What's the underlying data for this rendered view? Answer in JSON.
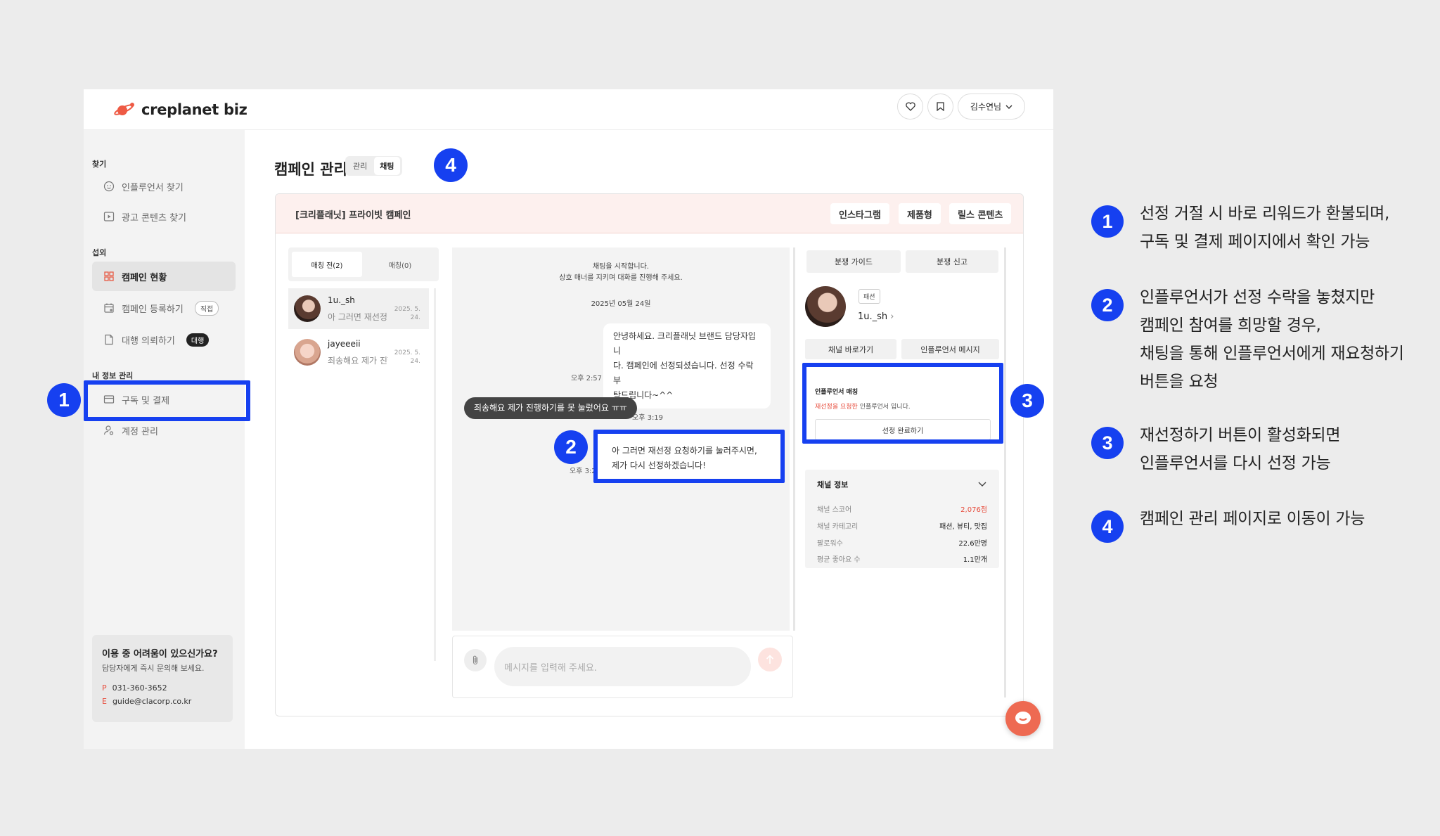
{
  "app": {
    "logo": "creplanet biz",
    "user": "김수연님"
  },
  "sidebar": {
    "sections": [
      {
        "title": "찾기",
        "items": [
          {
            "label": "인플루언서 찾기",
            "icon": "face-icon"
          },
          {
            "label": "광고 콘텐츠 찾기",
            "icon": "play-icon"
          }
        ]
      },
      {
        "title": "섭외",
        "items": [
          {
            "label": "캠페인 현황",
            "icon": "grid-icon"
          },
          {
            "label": "캠페인 등록하기",
            "icon": "calendar-add-icon",
            "badge": "직접"
          },
          {
            "label": "대행 의뢰하기",
            "icon": "document-icon",
            "badge": "대행"
          }
        ]
      },
      {
        "title": "내 정보 관리",
        "items": [
          {
            "label": "구독 및 결제",
            "icon": "card-icon"
          },
          {
            "label": "계정 관리",
            "icon": "user-gear-icon"
          }
        ]
      }
    ],
    "help": {
      "title": "이용 중 어려움이 있으신가요?",
      "subtitle": "담당자에게 즉시 문의해 보세요.",
      "phone_key": "P",
      "phone": "031-360-3652",
      "email_key": "E",
      "email": "guide@clacorp.co.kr"
    }
  },
  "page": {
    "title": "캠페인 관리",
    "tabs": [
      "관리",
      "채팅"
    ],
    "active_tab": "채팅"
  },
  "campaign": {
    "title": "[크리플래닛] 프라이빗 캠페인",
    "chips": [
      "인스타그램",
      "제품형",
      "릴스 콘텐츠"
    ]
  },
  "conversations": {
    "tabs": [
      "매칭 전(2)",
      "매칭(0)"
    ],
    "items": [
      {
        "name": "1u._sh",
        "preview": "아 그러면 재선정 요청하기를",
        "date1": "2025. 5.",
        "date2": "24."
      },
      {
        "name": "jayeeeii",
        "preview": "죄송해요 제가 진행하기를",
        "date1": "2025. 5.",
        "date2": "24."
      }
    ]
  },
  "chat": {
    "system1": "채팅을 시작합니다.",
    "system2": "상호 매너를 지키며 대화를 진행해 주세요.",
    "date": "2025년 05월 24일",
    "msg1": {
      "lines": [
        "안녕하세요. 크리플래닛 브랜드 담당자입니",
        "다. 캠페인에 선정되셨습니다. 선정 수락 부",
        "탁드립니다~^^"
      ],
      "time": "오후 2:57"
    },
    "msg2": {
      "text": "죄송해요 제가 진행하기를 못 눌렀어요 ㅠㅠ",
      "time": "오후 3:19"
    },
    "msg3": {
      "lines": [
        "아 그러면 재선정 요청하기를 눌러주시면,",
        "제가 다시 선정하겠습니다!"
      ],
      "time": "오후 3:2"
    },
    "input_placeholder": "메시지를 입력해 주세요."
  },
  "influencer": {
    "guide_buttons": [
      "분쟁 가이드",
      "분쟁 신고"
    ],
    "tag": "패션",
    "name": "1u._sh",
    "action_buttons": [
      "채널 바로가기",
      "인플루언서 메시지"
    ],
    "match": {
      "title": "인플루언서 매칭",
      "status_highlight": "재선정을 요청한",
      "status_rest": " 인플루언서 입니다.",
      "button": "선정 완료하기"
    },
    "channel": {
      "title": "채널 정보",
      "rows": [
        {
          "k": "채널 스코어",
          "v": "2,076점"
        },
        {
          "k": "채널 카테고리",
          "v": "패션, 뷰티, 맛집"
        },
        {
          "k": "팔로워수",
          "v": "22.6만명"
        },
        {
          "k": "평균 좋아요 수",
          "v": "1.1만개"
        }
      ]
    }
  },
  "markers": [
    "1",
    "2",
    "3",
    "4"
  ],
  "annotations": [
    {
      "num": "1",
      "lines": [
        "선정 거절 시 바로 리워드가 환불되며,",
        "구독 및 결제 페이지에서 확인 가능"
      ]
    },
    {
      "num": "2",
      "lines": [
        "인플루언서가 선정 수락을 놓쳤지만",
        "캠페인 참여를 희망할 경우,",
        "채팅을 통해 인플루언서에게 재요청하기",
        "버튼을 요청"
      ]
    },
    {
      "num": "3",
      "lines": [
        "재선정하기 버튼이 활성화되면",
        "인플루언서를 다시 선정 가능"
      ]
    },
    {
      "num": "4",
      "lines": [
        "캠페인 관리 페이지로 이동이 가능"
      ]
    }
  ],
  "colors": {
    "highlight": "#1640f0",
    "brand": "#ee6a52",
    "alert": "#e74c3c"
  }
}
